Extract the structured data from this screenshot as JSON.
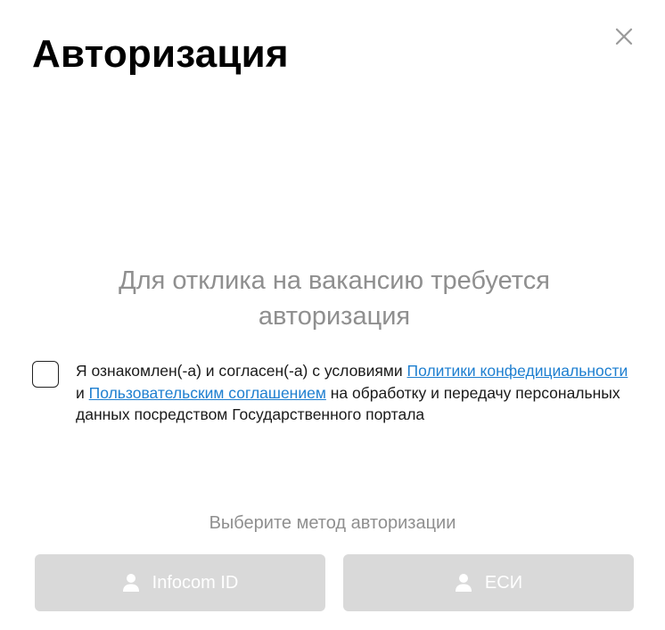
{
  "modal": {
    "title": "Авторизация",
    "close_icon": "close-icon"
  },
  "notice": {
    "text": "Для отклика на вакансию требуется авторизация"
  },
  "consent": {
    "checked": false,
    "text_part1": "Я ознакомлен(-а) и согласен(-а) с условиями ",
    "privacy_link": "Политики конфедициальности",
    "text_part2": " и ",
    "agreement_link": "Пользовательским соглашением",
    "text_part3": " на обработку и передачу персональных данных посредством Государственного портала",
    "link_color": "#1e7fd0"
  },
  "auth_methods": {
    "label": "Выберите метод авторизации",
    "buttons": [
      {
        "label": "Infocom ID",
        "icon": "user-icon"
      },
      {
        "label": "ЕСИ",
        "icon": "user-icon"
      }
    ],
    "button_color": "#d9d9d9"
  }
}
